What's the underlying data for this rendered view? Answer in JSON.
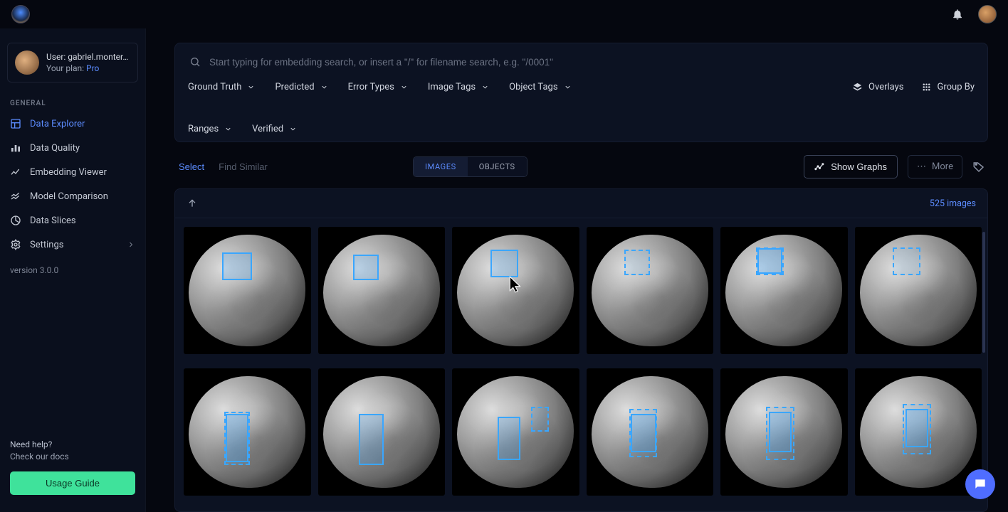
{
  "user": {
    "label": "User:",
    "name": "gabriel.monter…",
    "plan_label": "Your plan:",
    "plan": "Pro"
  },
  "sidebar": {
    "section": "GENERAL",
    "items": [
      {
        "label": "Data Explorer",
        "icon": "layout-icon",
        "active": true
      },
      {
        "label": "Data Quality",
        "icon": "bars-icon"
      },
      {
        "label": "Embedding Viewer",
        "icon": "scatter-icon"
      },
      {
        "label": "Model Comparison",
        "icon": "lines-icon"
      },
      {
        "label": "Data Slices",
        "icon": "pie-icon"
      },
      {
        "label": "Settings",
        "icon": "gear-icon",
        "chevron": true
      }
    ],
    "version": "version 3.0.0",
    "help_title": "Need help?",
    "help_sub": "Check our docs",
    "usage_guide": "Usage Guide"
  },
  "search": {
    "placeholder": "Start typing for embedding search, or insert a \"/\" for filename search, e.g. \"/0001\""
  },
  "filters": {
    "ground_truth": "Ground Truth",
    "predicted": "Predicted",
    "error_types": "Error Types",
    "image_tags": "Image Tags",
    "object_tags": "Object Tags",
    "ranges": "Ranges",
    "verified": "Verified",
    "overlays": "Overlays",
    "group_by": "Group By"
  },
  "toolbar": {
    "select": "Select",
    "find_similar": "Find Similar",
    "images_tab": "IMAGES",
    "objects_tab": "OBJECTS",
    "show_graphs": "Show Graphs",
    "more": "More"
  },
  "grid": {
    "count": "525 images"
  }
}
